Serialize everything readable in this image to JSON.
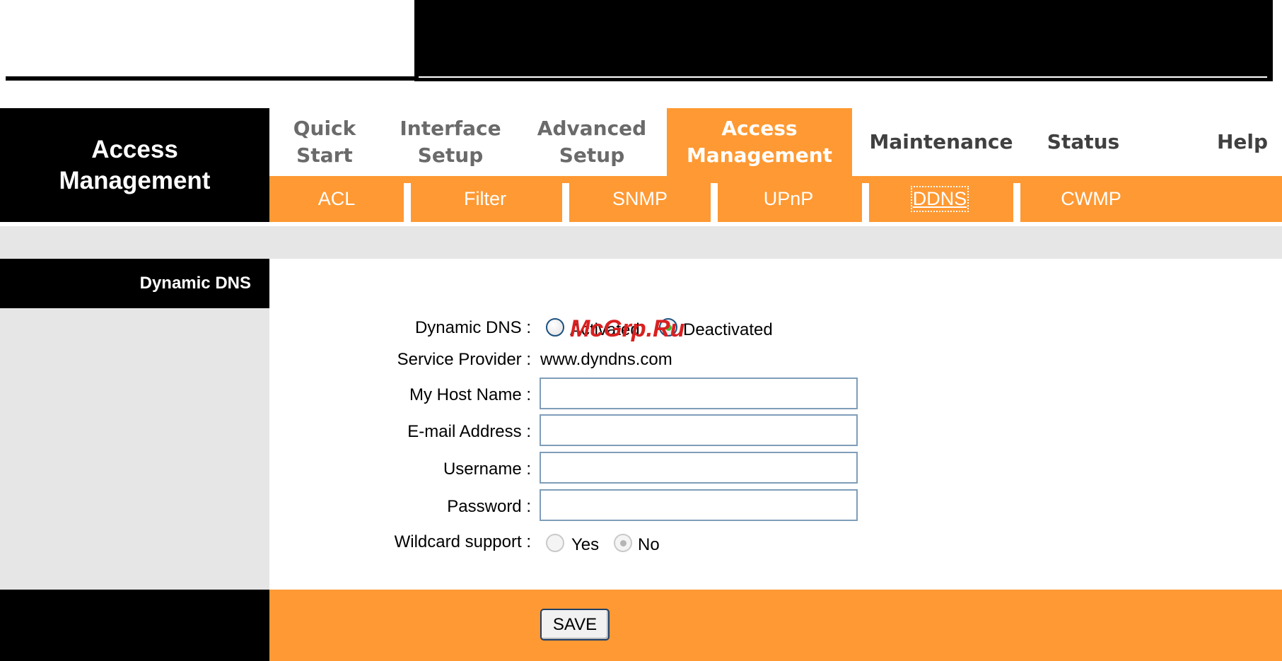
{
  "header": {
    "title_line1": "Access",
    "title_line2": "Management"
  },
  "nav": {
    "tabs": [
      {
        "label": "Quick\nStart"
      },
      {
        "label": "Interface\nSetup"
      },
      {
        "label": "Advanced\nSetup"
      },
      {
        "label": "Access\nManagement",
        "active": true
      },
      {
        "label": "Maintenance"
      },
      {
        "label": "Status"
      },
      {
        "label": "Help"
      }
    ]
  },
  "subnav": {
    "items": [
      "ACL",
      "Filter",
      "SNMP",
      "UPnP",
      "DDNS",
      "CWMP"
    ],
    "current": "DDNS"
  },
  "section": {
    "label": "Dynamic DNS"
  },
  "form": {
    "dynamic_dns": {
      "label": "Dynamic DNS :",
      "options": [
        "Activated",
        "Deactivated"
      ],
      "selected": "Deactivated"
    },
    "service_provider": {
      "label": "Service Provider :",
      "value": "www.dyndns.com"
    },
    "host_name": {
      "label": "My Host Name :",
      "value": ""
    },
    "email": {
      "label": "E-mail Address :",
      "value": ""
    },
    "username": {
      "label": "Username :",
      "value": ""
    },
    "password": {
      "label": "Password :",
      "value": ""
    },
    "wildcard": {
      "label": "Wildcard support :",
      "options": [
        "Yes",
        "No"
      ],
      "selected": "No"
    }
  },
  "footer": {
    "save_label": "SAVE"
  },
  "watermark": "McGrp.Ru",
  "colors": {
    "accent_orange": "#ff9933",
    "header_black": "#000000",
    "panel_gray": "#e6e6e6"
  }
}
